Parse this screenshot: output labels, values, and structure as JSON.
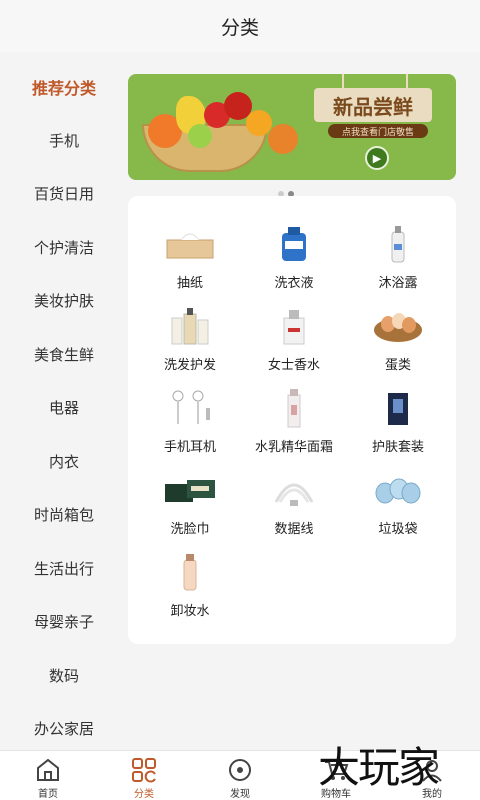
{
  "header": {
    "title": "分类"
  },
  "sidebar": {
    "items": [
      {
        "label": "推荐分类",
        "active": true
      },
      {
        "label": "手机"
      },
      {
        "label": "百货日用"
      },
      {
        "label": "个护清洁"
      },
      {
        "label": "美妆护肤"
      },
      {
        "label": "美食生鲜"
      },
      {
        "label": "电器"
      },
      {
        "label": "内衣"
      },
      {
        "label": "时尚箱包"
      },
      {
        "label": "生活出行"
      },
      {
        "label": "母婴亲子"
      },
      {
        "label": "数码"
      },
      {
        "label": "办公家居"
      }
    ]
  },
  "banner": {
    "headline": "新品尝鲜",
    "subline": "点我查看门店敬售",
    "accent_color": "#86b84a"
  },
  "categories": [
    {
      "label": "抽纸",
      "icon": "tissue-box-icon"
    },
    {
      "label": "洗衣液",
      "icon": "laundry-detergent-icon"
    },
    {
      "label": "沐浴露",
      "icon": "shower-gel-icon"
    },
    {
      "label": "洗发护发",
      "icon": "shampoo-icon"
    },
    {
      "label": "女士香水",
      "icon": "perfume-icon"
    },
    {
      "label": "蛋类",
      "icon": "eggs-icon"
    },
    {
      "label": "手机耳机",
      "icon": "earphones-icon"
    },
    {
      "label": "水乳精华面霜",
      "icon": "lotion-icon"
    },
    {
      "label": "护肤套装",
      "icon": "skincare-set-icon"
    },
    {
      "label": "洗脸巾",
      "icon": "face-towel-icon"
    },
    {
      "label": "数据线",
      "icon": "data-cable-icon"
    },
    {
      "label": "垃圾袋",
      "icon": "garbage-bag-icon"
    },
    {
      "label": "卸妆水",
      "icon": "makeup-remover-icon"
    }
  ],
  "tabbar": {
    "items": [
      {
        "label": "首页",
        "icon": "home-icon"
      },
      {
        "label": "分类",
        "icon": "category-icon",
        "active": true
      },
      {
        "label": "发现",
        "icon": "discover-icon"
      },
      {
        "label": "购物车",
        "icon": "cart-icon"
      },
      {
        "label": "我的",
        "icon": "profile-icon"
      }
    ]
  },
  "watermark": {
    "text": "大玩家"
  },
  "colors": {
    "accent": "#c0582a",
    "background": "#f4f4f4"
  }
}
